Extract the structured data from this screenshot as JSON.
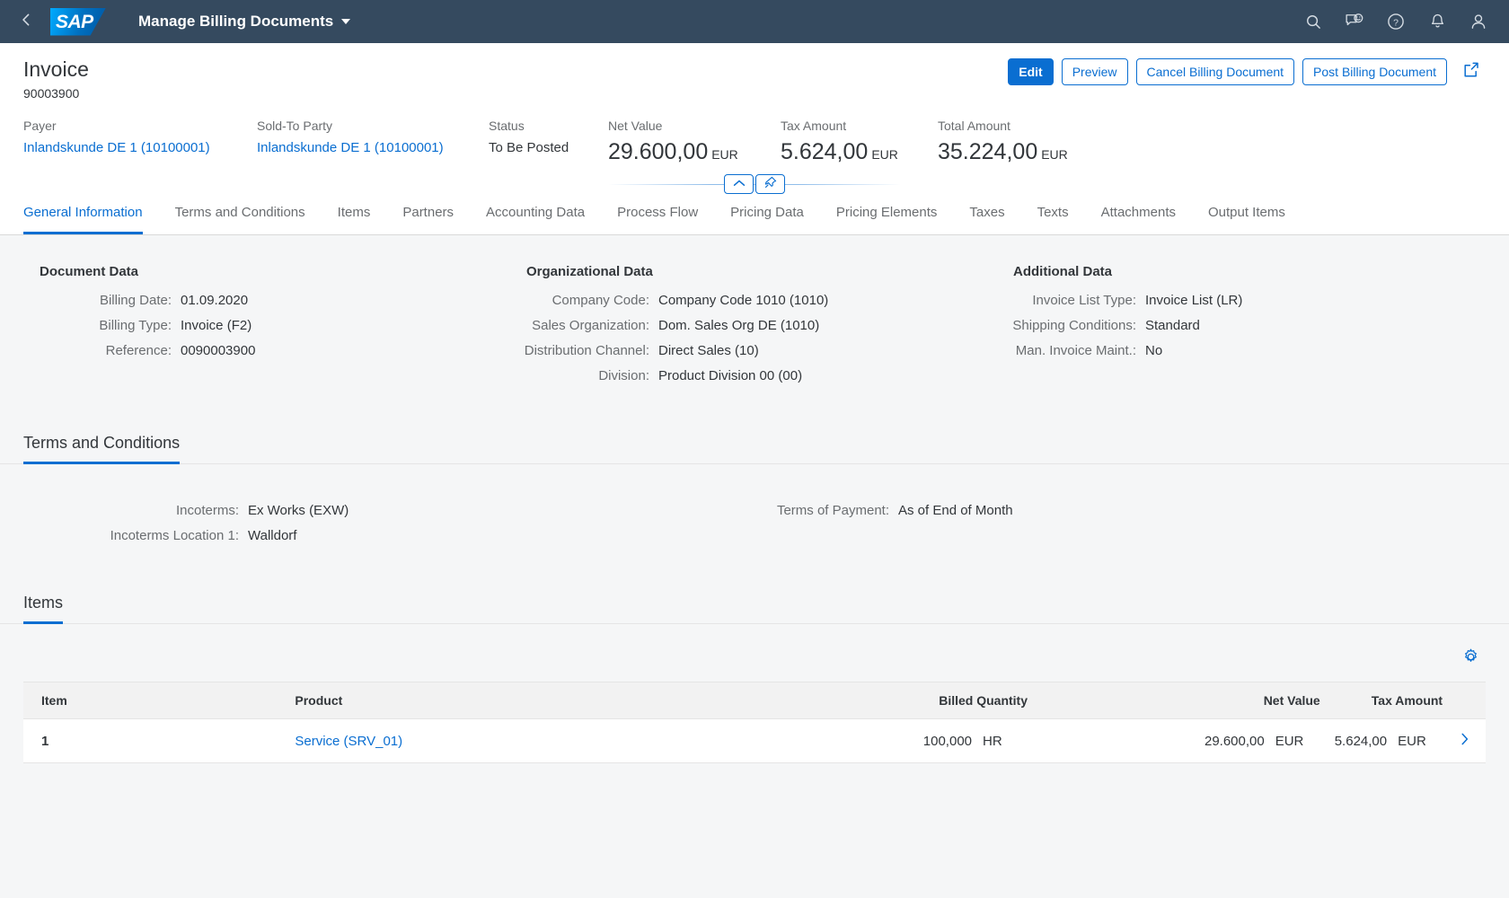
{
  "shellbar": {
    "back_icon": "chevron-left-icon",
    "logo_text": "SAP",
    "app_title": "Manage Billing Documents",
    "icons": [
      "search-icon",
      "feedback-icon",
      "help-icon",
      "notifications-icon",
      "user-icon"
    ]
  },
  "object_header": {
    "title": "Invoice",
    "subtitle": "90003900",
    "actions": {
      "edit": "Edit",
      "preview": "Preview",
      "cancel_billing_document": "Cancel Billing Document",
      "post_billing_document": "Post Billing Document",
      "share_icon": "share-icon"
    },
    "facets": [
      {
        "label": "Payer",
        "value": "Inlandskunde DE 1 (10100001)",
        "link": true
      },
      {
        "label": "Sold-To Party",
        "value": "Inlandskunde DE 1 (10100001)",
        "link": true
      },
      {
        "label": "Status",
        "value": "To Be Posted",
        "link": false
      }
    ],
    "amounts": [
      {
        "label": "Net Value",
        "value": "29.600,00",
        "unit": "EUR"
      },
      {
        "label": "Tax Amount",
        "value": "5.624,00",
        "unit": "EUR"
      },
      {
        "label": "Total Amount",
        "value": "35.224,00",
        "unit": "EUR"
      }
    ],
    "collapse_icon": "chevron-up-icon",
    "pin_icon": "pin-icon"
  },
  "tabs": [
    {
      "label": "General Information",
      "selected": true
    },
    {
      "label": "Terms and Conditions",
      "selected": false
    },
    {
      "label": "Items",
      "selected": false
    },
    {
      "label": "Partners",
      "selected": false
    },
    {
      "label": "Accounting Data",
      "selected": false
    },
    {
      "label": "Process Flow",
      "selected": false
    },
    {
      "label": "Pricing Data",
      "selected": false
    },
    {
      "label": "Pricing Elements",
      "selected": false
    },
    {
      "label": "Taxes",
      "selected": false
    },
    {
      "label": "Texts",
      "selected": false
    },
    {
      "label": "Attachments",
      "selected": false
    },
    {
      "label": "Output Items",
      "selected": false
    }
  ],
  "general_information": {
    "document_data": {
      "title": "Document Data",
      "fields": [
        {
          "label": "Billing Date:",
          "value": "01.09.2020"
        },
        {
          "label": "Billing Type:",
          "value": "Invoice (F2)"
        },
        {
          "label": "Reference:",
          "value": "0090003900"
        }
      ]
    },
    "organizational_data": {
      "title": "Organizational Data",
      "fields": [
        {
          "label": "Company Code:",
          "value": "Company Code 1010 (1010)"
        },
        {
          "label": "Sales Organization:",
          "value": "Dom. Sales Org DE (1010)"
        },
        {
          "label": "Distribution Channel:",
          "value": "Direct Sales (10)"
        },
        {
          "label": "Division:",
          "value": "Product Division 00 (00)"
        }
      ]
    },
    "additional_data": {
      "title": "Additional Data",
      "fields": [
        {
          "label": "Invoice List Type:",
          "value": "Invoice List (LR)"
        },
        {
          "label": "Shipping Conditions:",
          "value": "Standard"
        },
        {
          "label": "Man. Invoice Maint.:",
          "value": "No"
        }
      ]
    }
  },
  "terms_and_conditions": {
    "heading": "Terms and Conditions",
    "left_fields": [
      {
        "label": "Incoterms:",
        "value": "Ex Works (EXW)"
      },
      {
        "label": "Incoterms Location 1:",
        "value": "Walldorf"
      }
    ],
    "right_fields": [
      {
        "label": "Terms of Payment:",
        "value": "As of End of Month"
      }
    ]
  },
  "items_section": {
    "heading": "Items",
    "settings_icon": "gear-icon",
    "columns": [
      "Item",
      "Product",
      "Billed Quantity",
      "Net Value",
      "Tax Amount"
    ],
    "rows": [
      {
        "item": "1",
        "product": "Service (SRV_01)",
        "billed_quantity": "100,000",
        "billed_quantity_unit": "HR",
        "net_value": "29.600,00",
        "net_value_unit": "EUR",
        "tax_amount": "5.624,00",
        "tax_amount_unit": "EUR",
        "nav_icon": "chevron-right-icon"
      }
    ]
  },
  "colors": {
    "shell_bg": "#354a5f",
    "accent": "#0a6ed1",
    "content_bg": "#f5f6f7",
    "text": "#32363a",
    "label": "#6a6d70"
  }
}
